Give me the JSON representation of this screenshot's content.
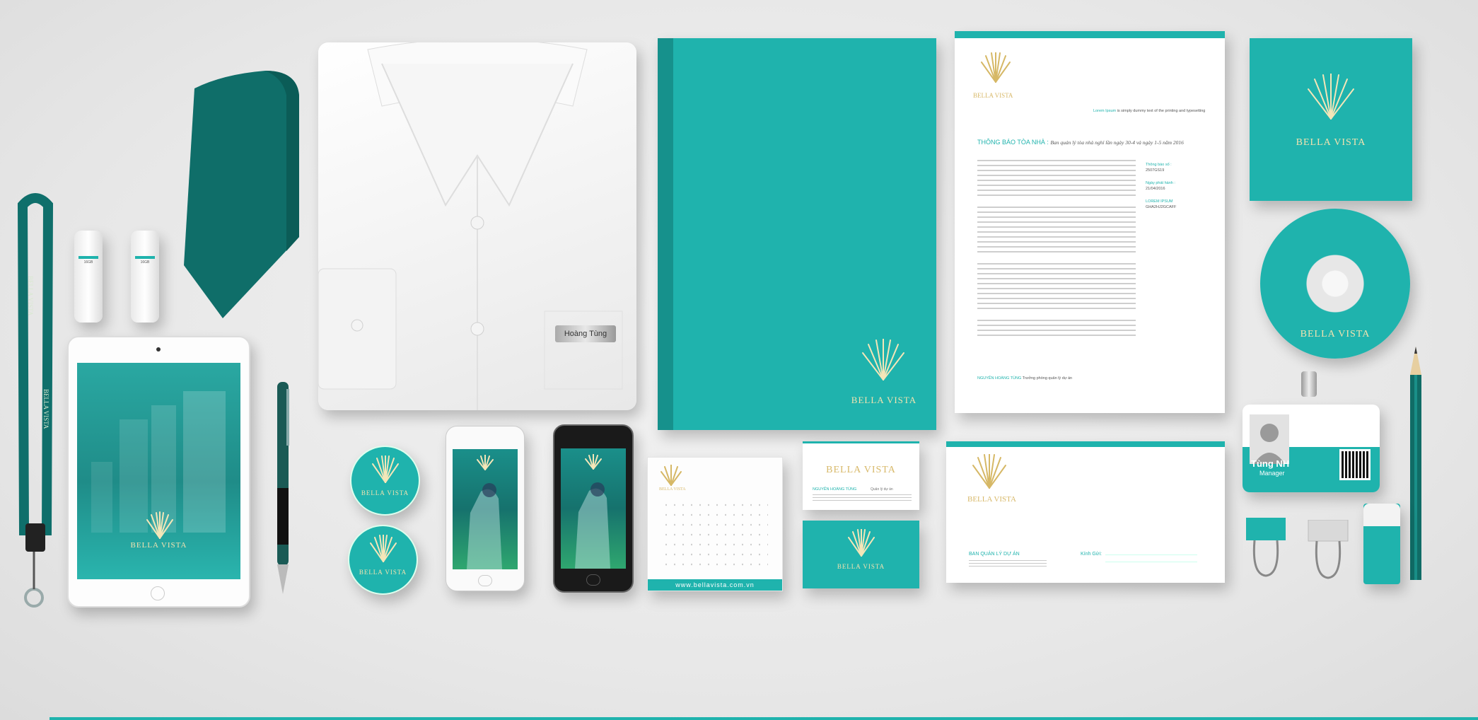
{
  "brand": {
    "name": "BELLA VISTA",
    "website": "www.bellavista.com.vn",
    "accent_color": "#1fb3ad",
    "accent_dark": "#0f7f79",
    "gold_color": "#d8b96a"
  },
  "badge": {
    "name": "Tùng NH",
    "role": "Manager"
  },
  "shirt": {
    "name_tag": "Hoàng Tùng"
  },
  "usb": {
    "label": "16GB"
  },
  "letterhead": {
    "tagline_lead": "Lorem Ipsum",
    "tagline": "is simply dummy text of the printing and typesetting",
    "heading": "THÔNG BÁO TÒA NHÀ :",
    "heading_sub": "Ban quản lý tòa nhà nghỉ lần ngày 30-4 và ngày 1-5 năm 2016",
    "side_label_1": "Thông báo số :",
    "side_value_1": "2507GS19",
    "side_label_2": "Ngày phát hành :",
    "side_value_2": "21/04/2016",
    "side_label_3": "LOREM IPSUM",
    "side_value_3": "GHA2HJ2GCAFF",
    "footer_name": "NGUYỄN HOÀNG TÙNG",
    "footer_role": "Trưởng phòng quản lý dự án"
  },
  "business_card": {
    "name": "NGUYỄN HOÀNG TÙNG",
    "role": "Quản lý dự án"
  },
  "envelope": {
    "sender": "BAN QUẢN LÝ DỰ ÁN",
    "recipient_label": "Kính Gửi:"
  }
}
